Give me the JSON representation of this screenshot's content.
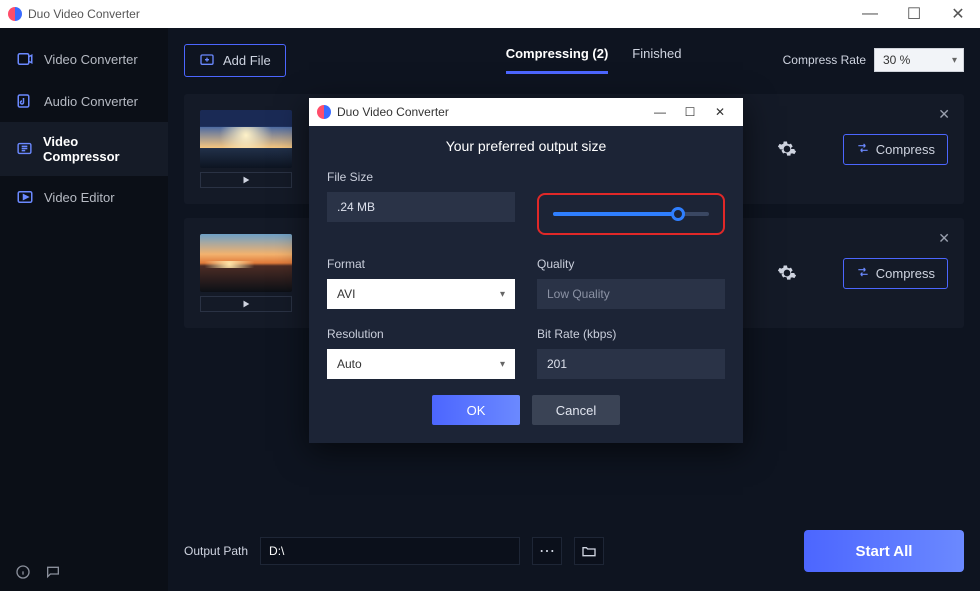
{
  "app": {
    "title": "Duo Video Converter"
  },
  "sidebar": {
    "items": [
      {
        "label": "Video Converter"
      },
      {
        "label": "Audio Converter"
      },
      {
        "label": "Video Compressor"
      },
      {
        "label": "Video Editor"
      }
    ]
  },
  "topbar": {
    "add_file": "Add File",
    "tabs": {
      "compressing": "Compressing (2)",
      "finished": "Finished"
    },
    "compress_rate_label": "Compress Rate",
    "compress_rate_value": "30 %"
  },
  "items": [
    {
      "compress_label": "Compress"
    },
    {
      "compress_label": "Compress"
    }
  ],
  "footer": {
    "output_path_label": "Output Path",
    "output_path_value": "D:\\",
    "start_all": "Start All"
  },
  "dialog": {
    "title": "Duo Video Converter",
    "heading": "Your preferred output size",
    "file_size_label": "File Size",
    "file_size_value": ".24 MB",
    "format_label": "Format",
    "format_value": "AVI",
    "quality_label": "Quality",
    "quality_value": "Low Quality",
    "resolution_label": "Resolution",
    "resolution_value": "Auto",
    "bitrate_label": "Bit Rate (kbps)",
    "bitrate_value": "201",
    "ok": "OK",
    "cancel": "Cancel"
  }
}
